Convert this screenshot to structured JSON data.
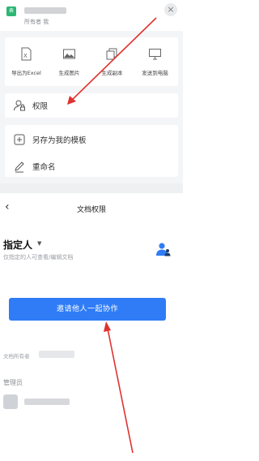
{
  "top": {
    "badge_text": "表",
    "owner_line": "所有者  我",
    "close_icon": "×"
  },
  "actions": [
    {
      "icon": "excel-icon",
      "label": "导出为Excel"
    },
    {
      "icon": "image-icon",
      "label": "生成图片"
    },
    {
      "icon": "copy-icon",
      "label": "生成副本"
    },
    {
      "icon": "monitor-icon",
      "label": "发送到电脑"
    }
  ],
  "menu": {
    "permission": {
      "icon": "user-lock-icon",
      "label": "权限"
    },
    "save_template": {
      "icon": "template-icon",
      "label": "另存为我的模板"
    },
    "rename": {
      "icon": "pencil-icon",
      "label": "重命名"
    }
  },
  "permission_panel": {
    "back_icon": "‹",
    "title": "文档权限",
    "scope_label": "指定人",
    "scope_caret": "▼",
    "scope_desc": "仅指定的人可查看/编辑文档",
    "invite_button": "邀请他人一起协作",
    "owner_label": "文档所有者",
    "admin_section": "管理员"
  },
  "colors": {
    "accent": "#2f7cf6",
    "annotation_red": "#e0322f",
    "sheet_green": "#2bb673"
  }
}
